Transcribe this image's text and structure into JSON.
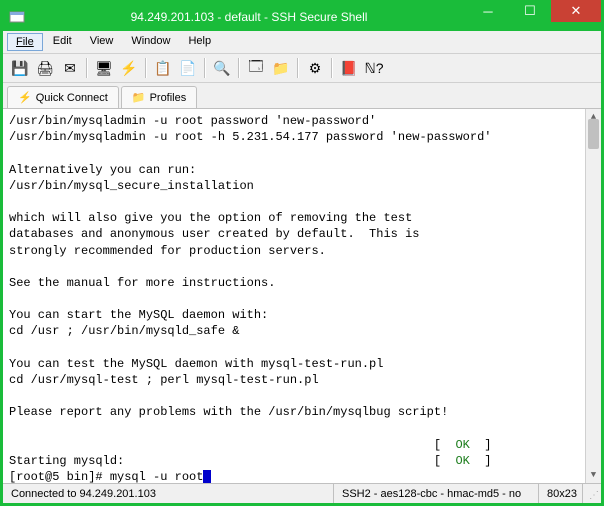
{
  "window": {
    "title": "94.249.201.103 - default - SSH Secure Shell"
  },
  "menus": {
    "file": "File",
    "edit": "Edit",
    "view": "View",
    "window": "Window",
    "help": "Help"
  },
  "tabs": {
    "quick_connect": "Quick Connect",
    "profiles": "Profiles"
  },
  "terminal": {
    "line1": "/usr/bin/mysqladmin -u root password 'new-password'",
    "line2": "/usr/bin/mysqladmin -u root -h 5.231.54.177 password 'new-password'",
    "line3": "",
    "line4": "Alternatively you can run:",
    "line5": "/usr/bin/mysql_secure_installation",
    "line6": "",
    "line7": "which will also give you the option of removing the test",
    "line8": "databases and anonymous user created by default.  This is",
    "line9": "strongly recommended for production servers.",
    "line10": "",
    "line11": "See the manual for more instructions.",
    "line12": "",
    "line13": "You can start the MySQL daemon with:",
    "line14": "cd /usr ; /usr/bin/mysqld_safe &",
    "line15": "",
    "line16": "You can test the MySQL daemon with mysql-test-run.pl",
    "line17": "cd /usr/mysql-test ; perl mysql-test-run.pl",
    "line18": "",
    "line19": "Please report any problems with the /usr/bin/mysqlbug script!",
    "line20": "",
    "ok1_pre": "                                                           [  ",
    "ok1": "OK",
    "ok1_post": "  ]",
    "starting_pre": "Starting mysqld:                                           [  ",
    "ok2": "OK",
    "starting_post": "  ]",
    "prompt": "[root@5 bin]# mysql -u root"
  },
  "status": {
    "connected": "Connected to 94.249.201.103",
    "cipher": "SSH2 - aes128-cbc - hmac-md5 - no",
    "size": "80x23"
  }
}
